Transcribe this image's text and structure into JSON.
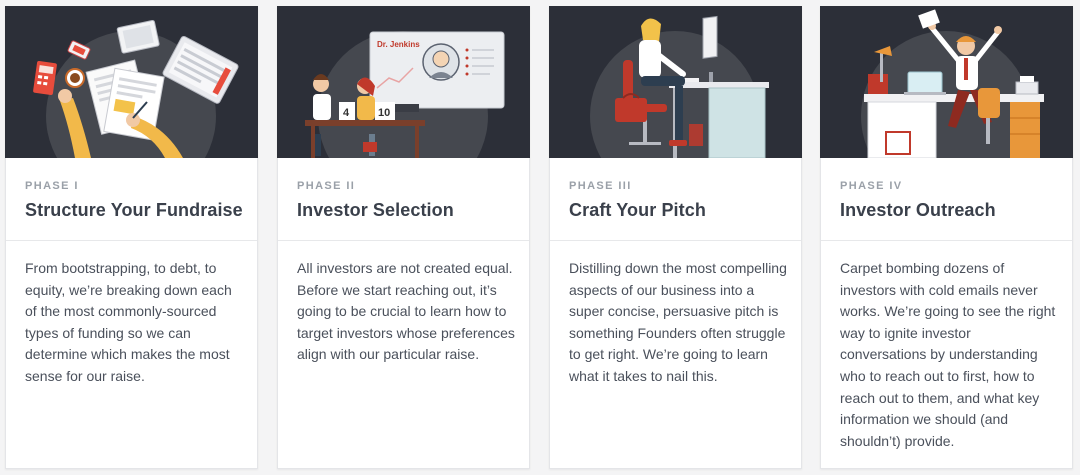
{
  "cards": [
    {
      "phase": "PHASE I",
      "title": "Structure Your Fundraise",
      "description": "From bootstrapping, to debt, to equity, we’re breaking down each of the most commonly-sourced types of funding so we can determine which makes the most sense for our raise."
    },
    {
      "phase": "PHASE II",
      "title": "Investor Selection",
      "description": "All investors are not created equal. Before we start reaching out, it’s going to be crucial to learn how to target investors whose preferences align with our particular raise.",
      "illustration": {
        "screen_name": "Dr. Jenkins",
        "board_number_left": "4",
        "board_number_right": "10"
      }
    },
    {
      "phase": "PHASE III",
      "title": "Craft Your Pitch",
      "description": "Distilling down the most compelling aspects of our business into a super concise, persuasive pitch is something Founders often struggle to get right. We’re going to learn what it takes to nail this."
    },
    {
      "phase": "PHASE IV",
      "title": "Investor Outreach",
      "description": "Carpet bombing dozens of investors with cold emails never works. We’re going to see the right way to ignite investor conversations by understanding who to reach out to first, how to reach out to them, and what key information we should (and shouldn’t) provide."
    }
  ],
  "colors": {
    "illustration_bg": "#2c2f38",
    "circle": "#45484f",
    "card_bg": "#ffffff",
    "page_bg": "#f4f4f5",
    "phase_text": "#9aa0a8",
    "title_text": "#3a404b",
    "body_text": "#4a505b"
  },
  "icons": [
    "desk-documents-illustration",
    "investor-selection-illustration",
    "pitch-desk-illustration",
    "outreach-office-illustration"
  ]
}
